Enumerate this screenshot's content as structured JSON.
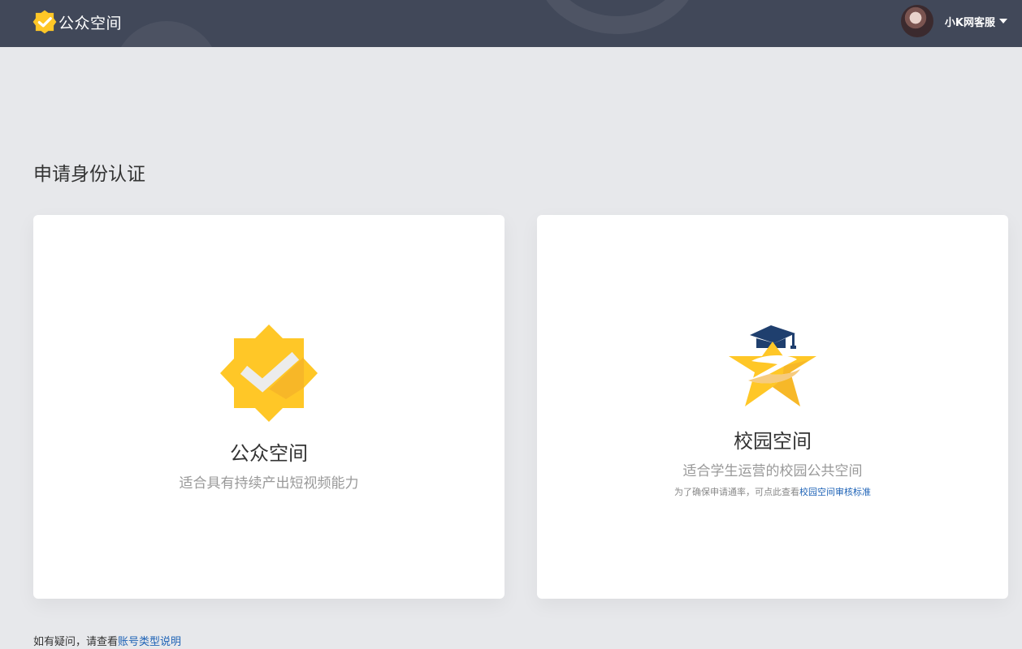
{
  "header": {
    "logo_text": "公众空间",
    "user_name": "小K网客服"
  },
  "page": {
    "title": "申请身份认证"
  },
  "cards": [
    {
      "title": "公众空间",
      "description": "适合具有持续产出短视频能力"
    },
    {
      "title": "校园空间",
      "description": "适合学生运营的校园公共空间",
      "note_prefix": "为了确保申请通率，可点此查看",
      "note_link": "校园空间审核标准"
    }
  ],
  "footer": {
    "prefix": "如有疑问，请查看",
    "link": "账号类型说明"
  },
  "colors": {
    "header_bg": "#414859",
    "page_bg": "#e7e8eb",
    "badge_yellow": "#ffc727",
    "link_blue": "#1d62b6",
    "cap_navy": "#1f3f6e"
  }
}
